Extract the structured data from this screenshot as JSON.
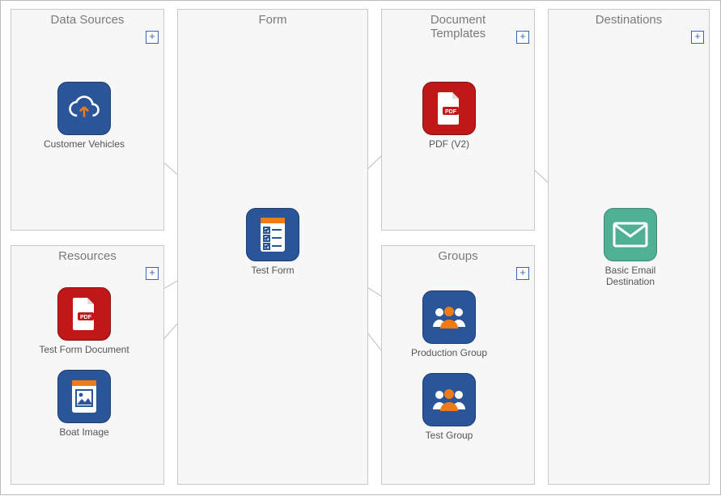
{
  "panels": {
    "dataSources": {
      "title": "Data Sources"
    },
    "form": {
      "title": "Form"
    },
    "docTemplates": {
      "title": "Document\nTemplates"
    },
    "destinations": {
      "title": "Destinations"
    },
    "resources": {
      "title": "Resources"
    },
    "groups": {
      "title": "Groups"
    }
  },
  "nodes": {
    "customerVehicles": {
      "label": "Customer Vehicles"
    },
    "resourcePdf": {
      "label": "Test Form Document",
      "badge": "PDF"
    },
    "boatImage": {
      "label": "Boat Image"
    },
    "testForm": {
      "label": "Test Form"
    },
    "templatePdf": {
      "label": "PDF (V2)",
      "badge": "PDF"
    },
    "prodGroup": {
      "label": "Production Group"
    },
    "testGroup": {
      "label": "Test Group"
    },
    "emailDest": {
      "label": "Basic Email Destination"
    }
  },
  "chart_data": {
    "type": "diagram",
    "title": "Form connection diagram",
    "edges": [
      [
        "Customer Vehicles",
        "Test Form"
      ],
      [
        "Test Form Document",
        "Test Form"
      ],
      [
        "Boat Image",
        "Test Form"
      ],
      [
        "Test Form",
        "PDF (V2)"
      ],
      [
        "Test Form",
        "Production Group"
      ],
      [
        "Test Form",
        "Test Group"
      ],
      [
        "PDF (V2)",
        "Basic Email Destination"
      ]
    ]
  }
}
